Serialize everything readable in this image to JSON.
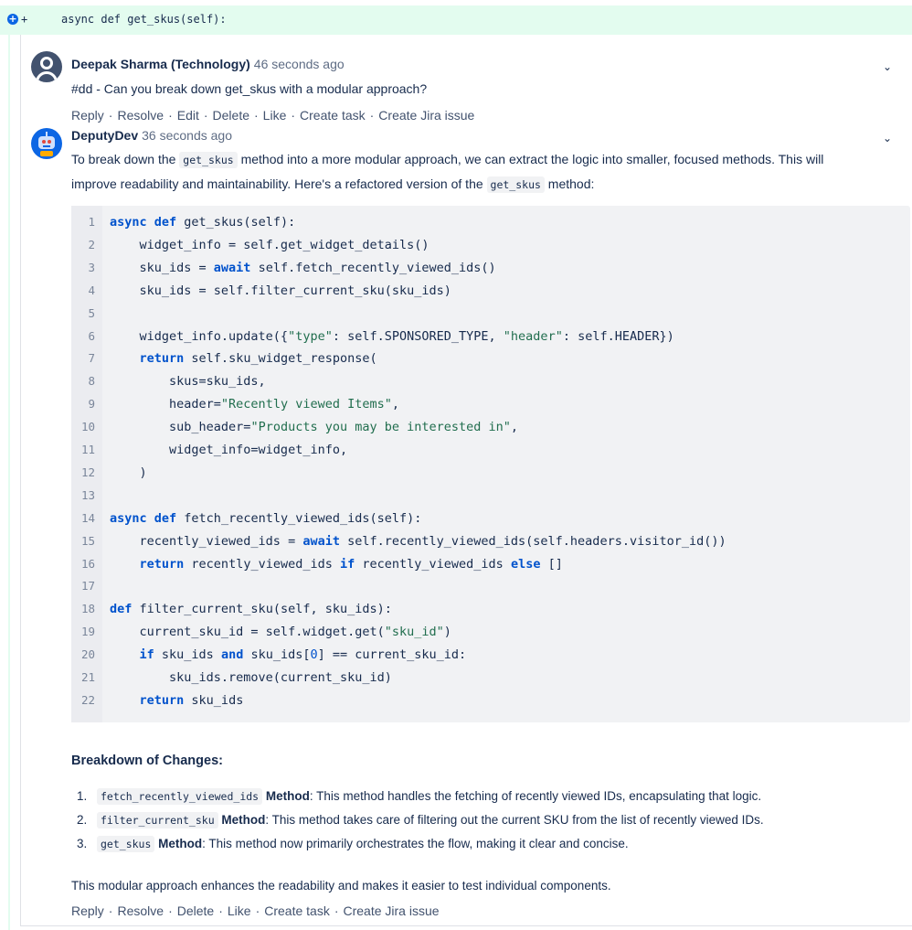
{
  "diff": {
    "add_symbol": "+",
    "add_button_symbol": "+",
    "code": "async def get_skus(self):"
  },
  "comment1": {
    "author": "Deepak Sharma (Technology)",
    "time": "46 seconds ago",
    "text": "#dd - Can you break down get_skus with a modular approach?",
    "actions": [
      "Reply",
      "Resolve",
      "Edit",
      "Delete",
      "Like",
      "Create task",
      "Create Jira issue"
    ]
  },
  "comment2": {
    "author": "DeputyDev",
    "time": "36 seconds ago",
    "intro": {
      "p1a": "To break down the ",
      "c1": "get_skus",
      "p1b": " method into a more modular approach, we can extract the logic into smaller, focused methods. This will",
      "p2a": "improve readability and maintainability. Here's a refactored version of the ",
      "c2": "get_skus",
      "p2b": " method:"
    },
    "code_lines": [
      "async def get_skus(self):",
      "    widget_info = self.get_widget_details()",
      "    sku_ids = await self.fetch_recently_viewed_ids()",
      "    sku_ids = self.filter_current_sku(sku_ids)",
      "",
      "    widget_info.update({\"type\": self.SPONSORED_TYPE, \"header\": self.HEADER})",
      "    return self.sku_widget_response(",
      "        skus=sku_ids,",
      "        header=\"Recently viewed Items\",",
      "        sub_header=\"Products you may be interested in\",",
      "        widget_info=widget_info,",
      "    )",
      "",
      "async def fetch_recently_viewed_ids(self):",
      "    recently_viewed_ids = await self.recently_viewed_ids(self.headers.visitor_id())",
      "    return recently_viewed_ids if recently_viewed_ids else []",
      "",
      "def filter_current_sku(self, sku_ids):",
      "    current_sku_id = self.widget.get(\"sku_id\")",
      "    if sku_ids and sku_ids[0] == current_sku_id:",
      "        sku_ids.remove(current_sku_id)",
      "    return sku_ids"
    ],
    "breakdown_title": "Breakdown of Changes:",
    "breakdown": [
      {
        "num": "1.",
        "code": "fetch_recently_viewed_ids",
        "bold": "Method",
        "text": ": This method handles the fetching of recently viewed IDs, encapsulating that logic."
      },
      {
        "num": "2.",
        "code": "filter_current_sku",
        "bold": "Method",
        "text": ": This method takes care of filtering out the current SKU from the list of recently viewed IDs."
      },
      {
        "num": "3.",
        "code": "get_skus",
        "bold": "Method",
        "text": ": This method now primarily orchestrates the flow, making it clear and concise."
      }
    ],
    "conclusion": "This modular approach enhances the readability and makes it easier to test individual components.",
    "actions": [
      "Reply",
      "Resolve",
      "Delete",
      "Like",
      "Create task",
      "Create Jira issue"
    ]
  },
  "icons": {
    "chevron": "⌄"
  }
}
